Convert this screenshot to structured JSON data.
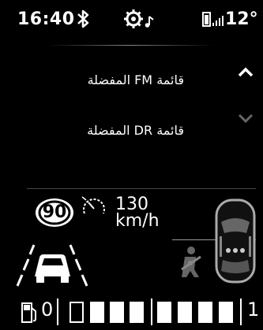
{
  "status": {
    "time": "16:40",
    "temperature": "12°",
    "bluetooth_icon": "bluetooth-icon",
    "settings_icon": "gear-music-icon",
    "phone_icon": "phone-battery-signal-icon"
  },
  "menu": {
    "items": [
      {
        "label": "قائمة FM المفضلة"
      },
      {
        "label": "قائمة DR المفضلة"
      }
    ],
    "up_icon": "chevron-up-icon",
    "down_icon": "chevron-down-icon"
  },
  "driver_assist": {
    "speed_limit": "90",
    "set_speed": "130",
    "set_speed_unit": "km/h",
    "cruise_icon": "speedometer-icon",
    "lane_icon": "lane-assist-icon",
    "seatbelt_icon": "seatbelt-warning-icon",
    "car_icon": "car-top-view-icon"
  },
  "fuel": {
    "min_label": "0",
    "max_label": "1",
    "level": 0.1,
    "icon": "fuel-pump-icon"
  }
}
